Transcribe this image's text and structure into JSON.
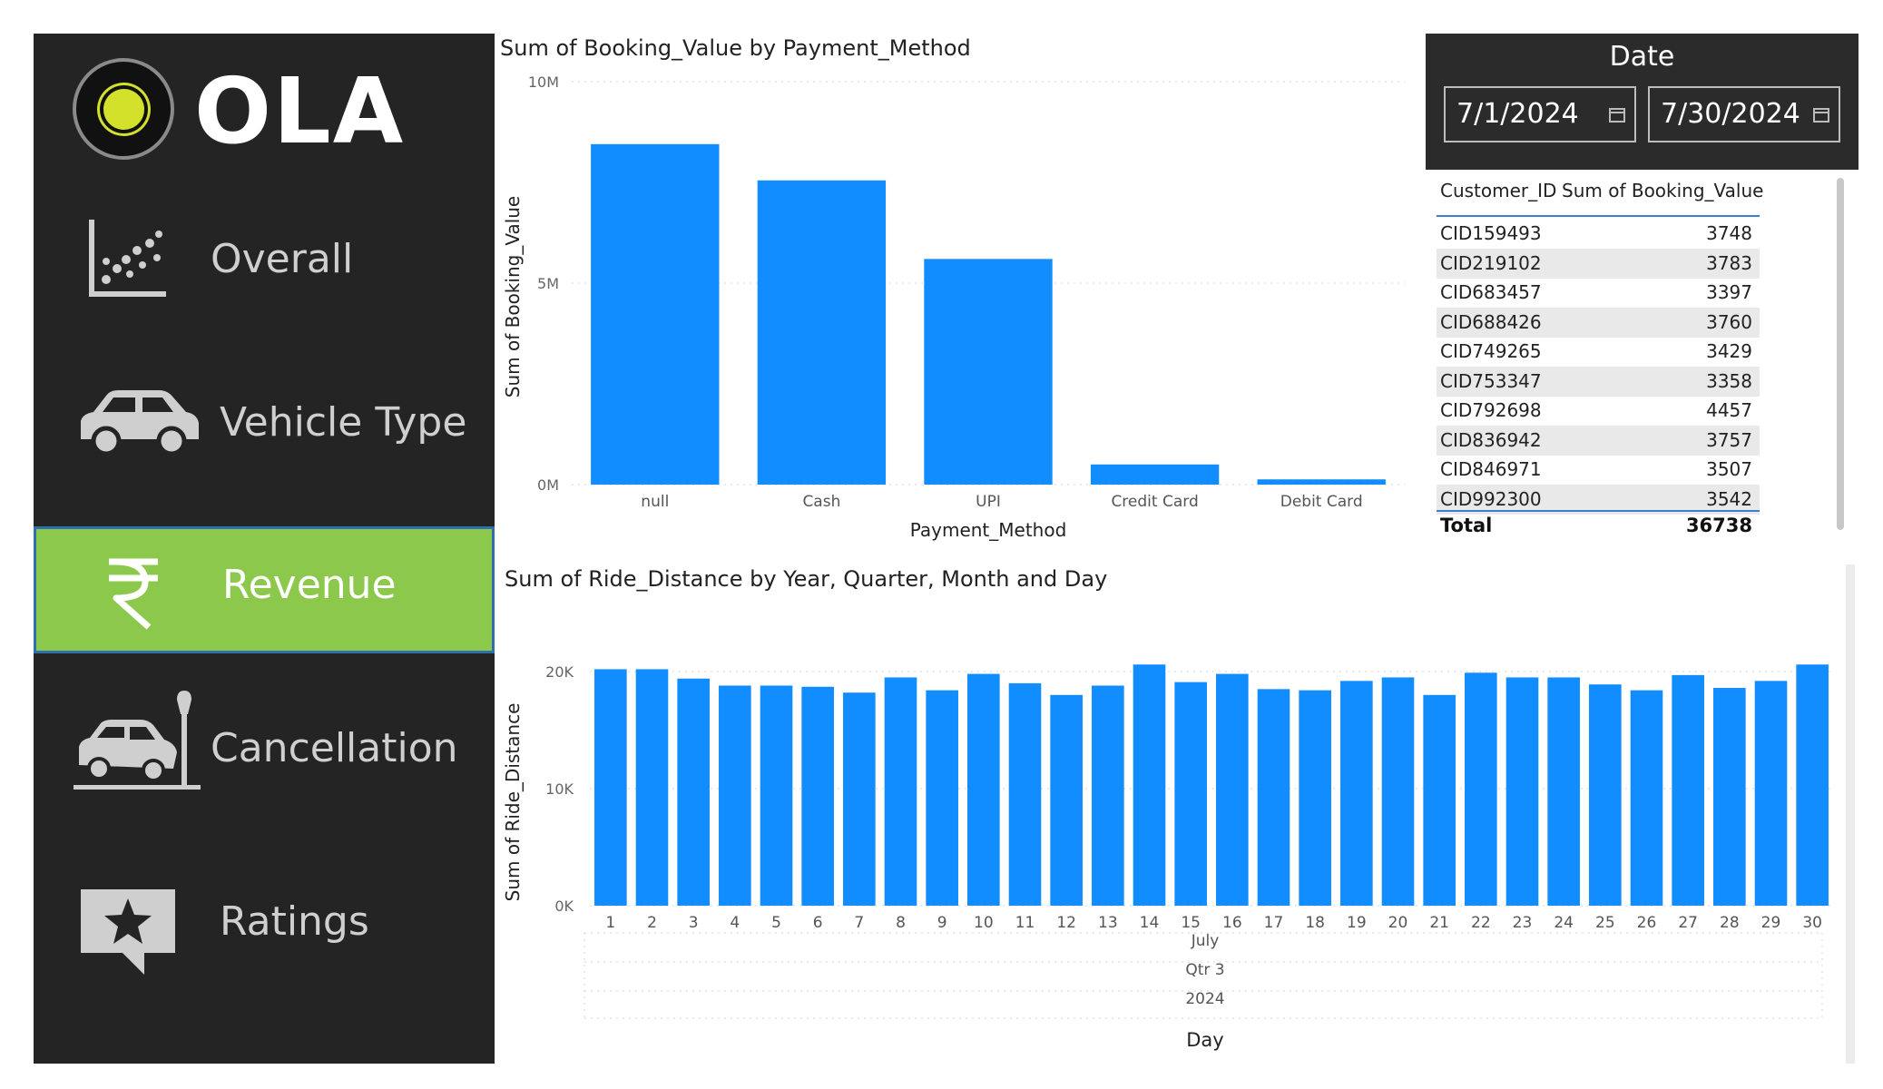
{
  "brand": {
    "name": "OLA",
    "accent": "#8cc84b",
    "logo_dot": "#d4e12a"
  },
  "nav": [
    {
      "label": "Overall",
      "icon": "scatter-chart-icon",
      "active": false
    },
    {
      "label": "Vehicle Type",
      "icon": "car-icon",
      "active": false
    },
    {
      "label": "Revenue",
      "icon": "rupee-icon",
      "active": true
    },
    {
      "label": "Cancellation",
      "icon": "car-crash-icon",
      "active": false
    },
    {
      "label": "Ratings",
      "icon": "star-message-icon",
      "active": false
    }
  ],
  "date_filter": {
    "title": "Date",
    "start": "7/1/2024",
    "end": "7/30/2024"
  },
  "table": {
    "headers": [
      "Customer_ID",
      "Sum of Booking_Value"
    ],
    "rows": [
      [
        "CID159493",
        "3748"
      ],
      [
        "CID219102",
        "3783"
      ],
      [
        "CID683457",
        "3397"
      ],
      [
        "CID688426",
        "3760"
      ],
      [
        "CID749265",
        "3429"
      ],
      [
        "CID753347",
        "3358"
      ],
      [
        "CID792698",
        "4457"
      ],
      [
        "CID836942",
        "3757"
      ],
      [
        "CID846971",
        "3507"
      ],
      [
        "CID992300",
        "3542"
      ]
    ],
    "total_label": "Total",
    "total_value": "36738"
  },
  "chart_data": [
    {
      "type": "bar",
      "title": "Sum of Booking_Value by Payment_Method",
      "xlabel": "Payment_Method",
      "ylabel": "Sum of Booking_Value",
      "categories": [
        "null",
        "Cash",
        "UPI",
        "Credit Card",
        "Debit Card"
      ],
      "values": [
        8450000,
        7550000,
        5600000,
        500000,
        130000
      ],
      "ylim": [
        0,
        10000000
      ],
      "yticks": [
        "0M",
        "5M",
        "10M"
      ],
      "color": "#118dff",
      "grid": true
    },
    {
      "type": "bar",
      "title": "Sum of Ride_Distance by Year, Quarter, Month and Day",
      "xlabel": "Day",
      "ylabel": "Sum of Ride_Distance",
      "categories": [
        "1",
        "2",
        "3",
        "4",
        "5",
        "6",
        "7",
        "8",
        "9",
        "10",
        "11",
        "12",
        "13",
        "14",
        "15",
        "16",
        "17",
        "18",
        "19",
        "20",
        "21",
        "22",
        "23",
        "24",
        "25",
        "26",
        "27",
        "28",
        "29",
        "30"
      ],
      "values": [
        20200,
        20200,
        19400,
        18800,
        18800,
        18700,
        18200,
        19500,
        18400,
        19800,
        19000,
        18000,
        18800,
        20600,
        19100,
        19800,
        18500,
        18400,
        19200,
        19500,
        18000,
        19900,
        19500,
        19500,
        18900,
        18400,
        19700,
        18600,
        19200,
        20600
      ],
      "hierarchy": {
        "month": "July",
        "quarter": "Qtr 3",
        "year": "2024"
      },
      "ylim": [
        0,
        20000
      ],
      "yticks": [
        "0K",
        "10K",
        "20K"
      ],
      "color": "#118dff",
      "grid": true
    }
  ]
}
